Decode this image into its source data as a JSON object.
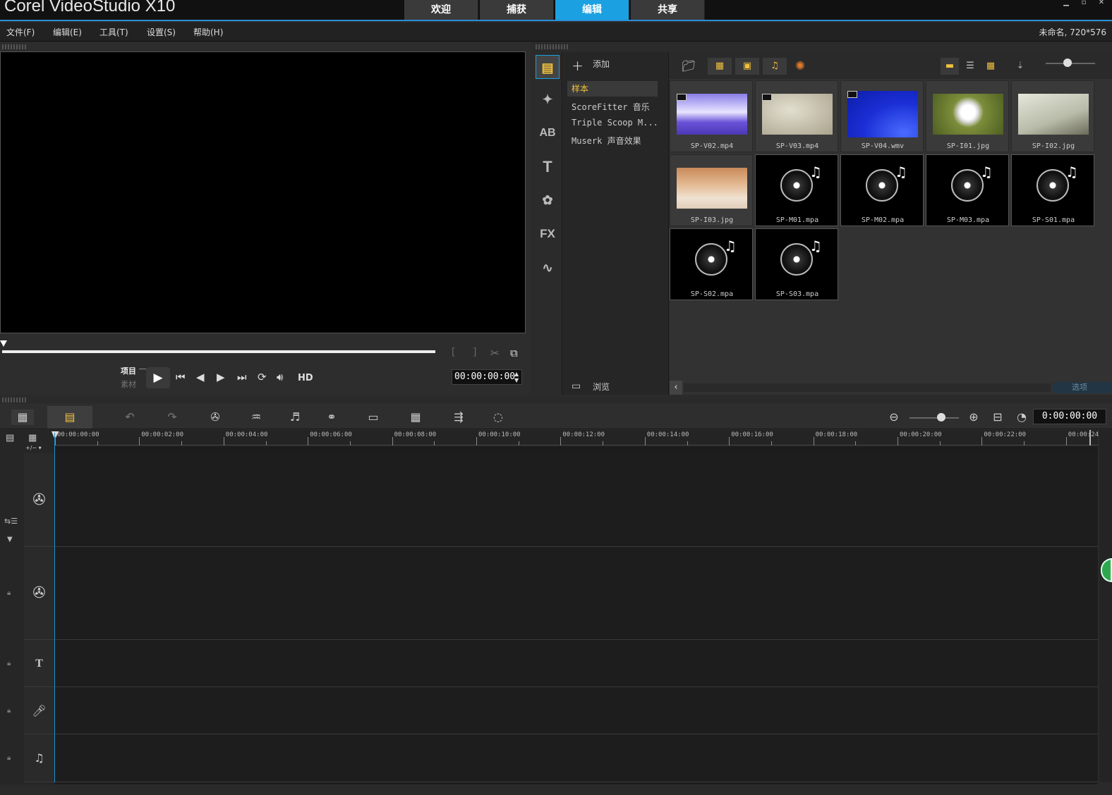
{
  "app": {
    "brand": "Corel VideoStudio X10"
  },
  "main_tabs": [
    {
      "label": "欢迎"
    },
    {
      "label": "捕获"
    },
    {
      "label": "编辑",
      "active": true
    },
    {
      "label": "共享"
    }
  ],
  "menu": {
    "items": [
      "文件(F)",
      "编辑(E)",
      "工具(T)",
      "设置(S)",
      "帮助(H)"
    ],
    "project_info": "未命名, 720*576"
  },
  "player": {
    "mode_project": "项目",
    "mode_clip": "素材",
    "hd_label": "HD",
    "timecode": "00:00:00:00"
  },
  "library": {
    "add_label": "添加",
    "browse_label": "浏览",
    "options_label": "选项",
    "folders": [
      "样本",
      "ScoreFitter 音乐",
      "Triple Scoop M...",
      "Muserk 声音效果"
    ],
    "category_icons": [
      "media-icon",
      "instant-project-icon",
      "transition-icon",
      "title-icon",
      "graphic-icon",
      "filter-icon",
      "path-icon"
    ],
    "items": [
      {
        "name": "SP-V02.mp4",
        "kind": "video",
        "thumb": "purple-bokeh"
      },
      {
        "name": "SP-V03.mp4",
        "kind": "video",
        "thumb": "beige"
      },
      {
        "name": "SP-V04.wmv",
        "kind": "video",
        "thumb": "blue"
      },
      {
        "name": "SP-I01.jpg",
        "kind": "image",
        "thumb": "dandelion"
      },
      {
        "name": "SP-I02.jpg",
        "kind": "image",
        "thumb": "trees"
      },
      {
        "name": "SP-I03.jpg",
        "kind": "image",
        "thumb": "desert"
      },
      {
        "name": "SP-M01.mpa",
        "kind": "audio",
        "thumb": "disc"
      },
      {
        "name": "SP-M02.mpa",
        "kind": "audio",
        "thumb": "disc"
      },
      {
        "name": "SP-M03.mpa",
        "kind": "audio",
        "thumb": "disc"
      },
      {
        "name": "SP-S01.mpa",
        "kind": "audio",
        "thumb": "disc"
      },
      {
        "name": "SP-S02.mpa",
        "kind": "audio",
        "thumb": "disc"
      },
      {
        "name": "SP-S03.mpa",
        "kind": "audio",
        "thumb": "disc"
      }
    ]
  },
  "timeline": {
    "timecode": "0:00:00:00",
    "ruler": [
      "00:00:00:00",
      "00:00:02:00",
      "00:00:04:00",
      "00:00:06:00",
      "00:00:08:00",
      "00:00:10:00",
      "00:00:12:00",
      "00:00:14:00",
      "00:00:16:00",
      "00:00:18:00",
      "00:00:20:00",
      "00:00:22:00",
      "00:00:24"
    ],
    "tracks": [
      {
        "name": "video-track",
        "icon": "film-reel-icon"
      },
      {
        "name": "overlay-track",
        "icon": "film-reel-icon"
      },
      {
        "name": "title-track",
        "icon": "title-t-icon"
      },
      {
        "name": "voice-track",
        "icon": "microphone-icon"
      },
      {
        "name": "music-track",
        "icon": "music-note-icon"
      }
    ]
  }
}
